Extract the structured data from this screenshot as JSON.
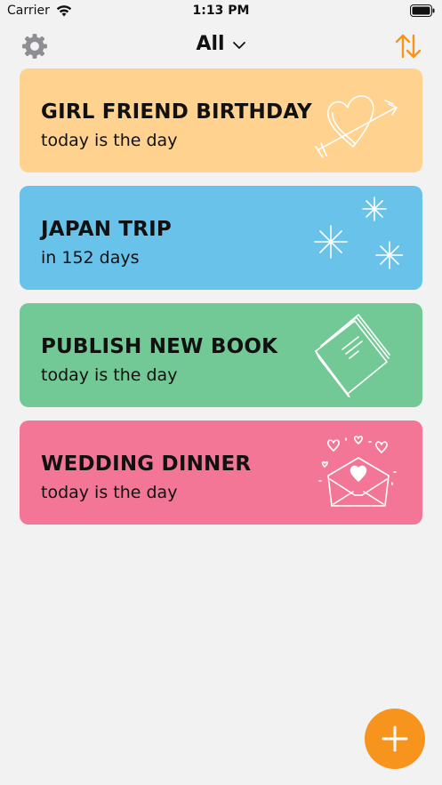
{
  "status_bar": {
    "carrier": "Carrier",
    "time": "1:13 PM"
  },
  "nav": {
    "filter_label": "All",
    "settings_icon": "gear-icon",
    "sort_icon": "sort-arrows-icon"
  },
  "cards": [
    {
      "title": "GIRL FRIEND BIRTHDAY",
      "subtitle": "today is the day",
      "color": "#ffd28f",
      "art_icon": "heart-arrow-icon"
    },
    {
      "title": "JAPAN TRIP",
      "subtitle": "in 152 days",
      "color": "#69c2ea",
      "art_icon": "sparkles-icon"
    },
    {
      "title": "PUBLISH NEW BOOK",
      "subtitle": "today is the day",
      "color": "#72c995",
      "art_icon": "book-icon"
    },
    {
      "title": "WEDDING DINNER",
      "subtitle": "today is the day",
      "color": "#f37696",
      "art_icon": "love-letter-icon"
    }
  ],
  "colors": {
    "background": "#f2f2f2",
    "accent": "#f7941d"
  },
  "fab": {
    "icon": "plus-icon"
  }
}
